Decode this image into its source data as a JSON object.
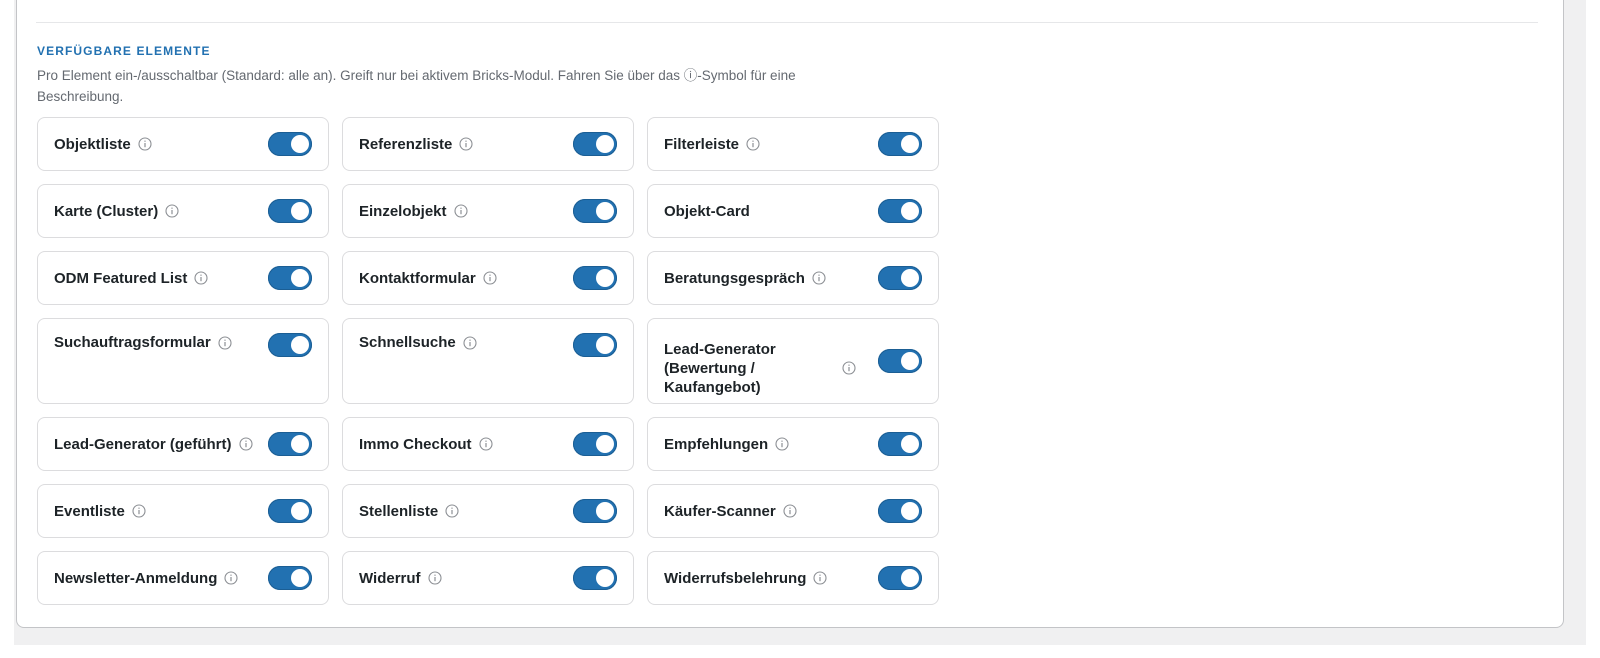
{
  "section": {
    "title": "VERFÜGBARE ELEMENTE",
    "description": "Pro Element ein-/ausschaltbar (Standard: alle an). Greift nur bei aktivem Bricks-Modul. Fahren Sie über das ⓘ-Symbol für eine Beschreibung."
  },
  "colors": {
    "accent": "#2271b1",
    "heading": "#2271b1",
    "text": "#1d2327",
    "muted": "#646970",
    "border": "#dcdcde"
  },
  "icons": {
    "info": "info-circle-icon"
  },
  "elements": [
    {
      "label": "Objektliste",
      "info": true,
      "enabled": true
    },
    {
      "label": "Referenzliste",
      "info": true,
      "enabled": true
    },
    {
      "label": "Filterleiste",
      "info": true,
      "enabled": true
    },
    {
      "label": "Karte (Cluster)",
      "info": true,
      "enabled": true
    },
    {
      "label": "Einzelobjekt",
      "info": true,
      "enabled": true
    },
    {
      "label": "Objekt-Card",
      "info": false,
      "enabled": true
    },
    {
      "label": "ODM Featured List",
      "info": true,
      "enabled": true
    },
    {
      "label": "Kontaktformular",
      "info": true,
      "enabled": true
    },
    {
      "label": "Beratungsgespräch",
      "info": true,
      "enabled": true
    },
    {
      "label": "Suchauftragsformular",
      "info": true,
      "enabled": true
    },
    {
      "label": "Schnellsuche",
      "info": true,
      "enabled": true
    },
    {
      "label": "Lead-Generator (Bewertung / Kaufangebot)",
      "info": true,
      "enabled": true
    },
    {
      "label": "Lead-Generator (geführt)",
      "info": true,
      "enabled": true
    },
    {
      "label": "Immo Checkout",
      "info": true,
      "enabled": true
    },
    {
      "label": "Empfehlungen",
      "info": true,
      "enabled": true
    },
    {
      "label": "Eventliste",
      "info": true,
      "enabled": true
    },
    {
      "label": "Stellenliste",
      "info": true,
      "enabled": true
    },
    {
      "label": "Käufer-Scanner",
      "info": true,
      "enabled": true
    },
    {
      "label": "Newsletter-Anmeldung",
      "info": true,
      "enabled": true
    },
    {
      "label": "Widerruf",
      "info": true,
      "enabled": true
    },
    {
      "label": "Widerrufsbelehrung",
      "info": true,
      "enabled": true
    }
  ]
}
